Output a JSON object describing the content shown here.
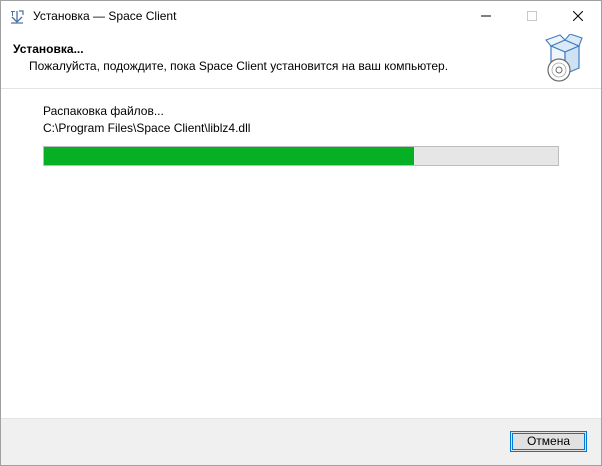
{
  "window": {
    "title": "Установка — Space Client",
    "app_icon": "installer-icon"
  },
  "titlebar_buttons": {
    "minimize_icon": "minimize-icon",
    "maximize_icon": "maximize-icon",
    "close_icon": "close-icon"
  },
  "header": {
    "title": "Установка...",
    "subtitle": "Пожалуйста, подождите, пока Space Client установится на ваш компьютер.",
    "icon": "install-box-disc-icon"
  },
  "progress": {
    "status": "Распаковка файлов...",
    "detail": "C:\\Program Files\\Space Client\\liblz4.dll",
    "fraction": 0.72,
    "fill_color": "#06b025"
  },
  "footer": {
    "cancel_label": "Отмена"
  }
}
